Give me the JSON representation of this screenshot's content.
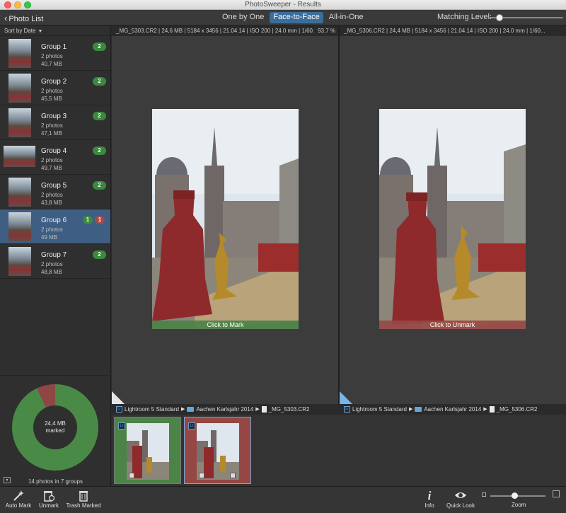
{
  "window": {
    "title": "PhotoSweeper - Results"
  },
  "toolbar": {
    "back_label": "Photo List",
    "modes": [
      "One by One",
      "Face-to-Face",
      "All-in-One"
    ],
    "active_mode": "Face-to-Face",
    "matching_label": "Matching Level:",
    "matching_level": 0.15
  },
  "sidebar": {
    "sort_label": "Sort by Date",
    "groups": [
      {
        "name": "Group 1",
        "photos": "2 photos",
        "size": "40,7 MB",
        "badges": [
          "2"
        ]
      },
      {
        "name": "Group 2",
        "photos": "2 photos",
        "size": "45,5 MB",
        "badges": [
          "2"
        ]
      },
      {
        "name": "Group 3",
        "photos": "2 photos",
        "size": "47,1 MB",
        "badges": [
          "2"
        ]
      },
      {
        "name": "Group 4",
        "photos": "2 photos",
        "size": "49,7 MB",
        "badges": [
          "2"
        ]
      },
      {
        "name": "Group 5",
        "photos": "2 photos",
        "size": "43,8 MB",
        "badges": [
          "2"
        ]
      },
      {
        "name": "Group 6",
        "photos": "2 photos",
        "size": "49 MB",
        "badges": [
          "1",
          "1"
        ]
      },
      {
        "name": "Group 7",
        "photos": "2 photos",
        "size": "48,8 MB",
        "badges": [
          "2"
        ]
      }
    ],
    "selected_group": "Group 6",
    "donut_line1": "24,4 MB",
    "donut_line2": "marked",
    "marked_fraction": 0.07,
    "summary": "14 photos in 7 groups",
    "colors": {
      "kept": "#4a8a47",
      "marked": "#8e4745"
    }
  },
  "left_pane": {
    "info": "_MG_5303.CR2 | 24,6 MB | 5184 x 3456 | 21.04.14 | ISO 200 | 24.0 mm | 1/60...",
    "zoom": "93,7 %",
    "mark_label": "Click to Mark",
    "path": [
      "Lightroom 5 Standard",
      "Aachen Karlsjahr 2014",
      "_MG_5303.CR2"
    ]
  },
  "right_pane": {
    "info": "_MG_5306.CR2 | 24,4 MB | 5184 x 3456 | 21.04.14 | ISO 200 | 24.0 mm | 1/60...",
    "mark_label": "Click to Unmark",
    "path": [
      "Lightroom 5 Standard",
      "Aachen Karlsjahr 2014",
      "_MG_5306.CR2"
    ]
  },
  "bottombar": {
    "auto_mark": "Auto Mark",
    "unmark": "Unmark",
    "trash_marked": "Trash Marked",
    "info": "Info",
    "quick_look": "Quick Look",
    "zoom": "Zoom",
    "zoom_level": 0.43
  }
}
